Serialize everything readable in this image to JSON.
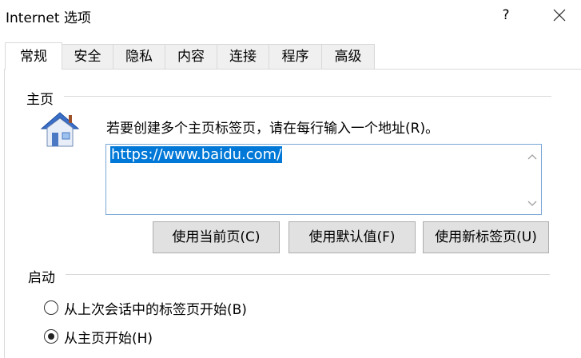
{
  "window": {
    "title": "Internet 选项",
    "help_label": "?"
  },
  "tabs": [
    "常规",
    "安全",
    "隐私",
    "内容",
    "连接",
    "程序",
    "高级"
  ],
  "active_tab": 0,
  "homepage": {
    "section_label": "主页",
    "instruction": "若要创建多个主页标签页，请在每行输入一个地址(R)。",
    "url_value": "https://www.baidu.com/",
    "buttons": {
      "use_current": "使用当前页(C)",
      "use_default": "使用默认值(F)",
      "use_new_tab": "使用新标签页(U)"
    }
  },
  "startup": {
    "section_label": "启动",
    "options": [
      {
        "label": "从上次会话中的标签页开始(B)",
        "selected": false
      },
      {
        "label": "从主页开始(H)",
        "selected": true
      }
    ]
  },
  "colors": {
    "selection": "#0078d7",
    "button_bg": "#e1e1e1",
    "accent_border": "#7aa7d6"
  }
}
